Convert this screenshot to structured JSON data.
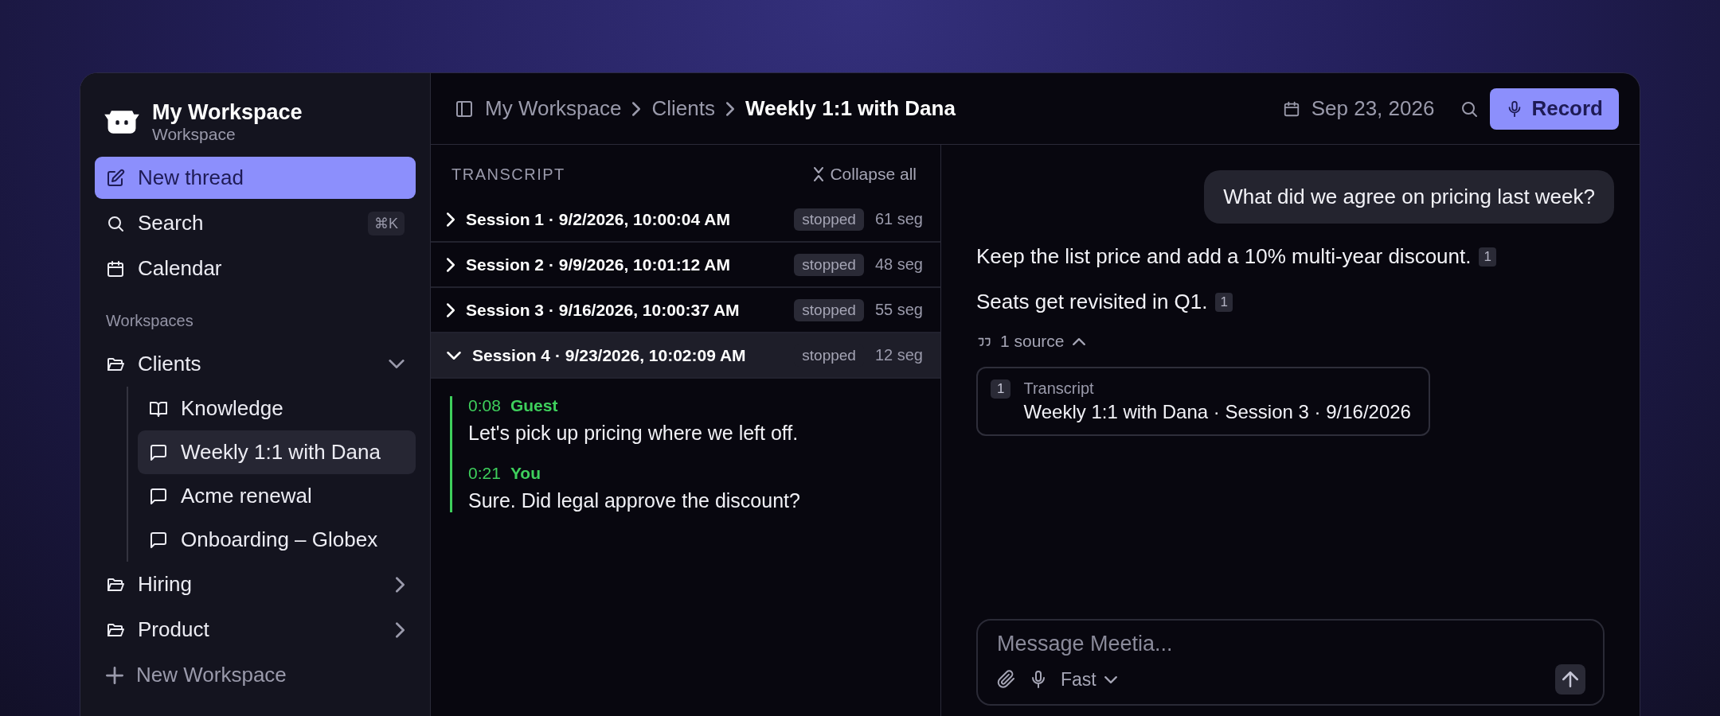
{
  "sidebar": {
    "workspace_name": "My Workspace",
    "workspace_subtitle": "Workspace",
    "nav": [
      {
        "label": "New thread",
        "kind": "primary"
      },
      {
        "label": "Search",
        "kind": "search",
        "shortcut": "⌘K"
      },
      {
        "label": "Calendar",
        "kind": "calendar"
      }
    ],
    "section_label": "Workspaces",
    "folders": [
      {
        "label": "Clients",
        "expanded": true,
        "children": [
          {
            "label": "Knowledge",
            "kind": "book",
            "selected": false
          },
          {
            "label": "Weekly 1:1 with Dana",
            "kind": "chat",
            "selected": true
          },
          {
            "label": "Acme renewal",
            "kind": "chat",
            "selected": false
          },
          {
            "label": "Onboarding – Globex",
            "kind": "chat",
            "selected": false
          }
        ]
      },
      {
        "label": "Hiring",
        "expanded": false
      },
      {
        "label": "Product",
        "expanded": false
      }
    ],
    "add_workspace": "New Workspace"
  },
  "header": {
    "breadcrumbs": [
      {
        "label": "My Workspace",
        "current": false
      },
      {
        "label": "Clients",
        "current": false
      },
      {
        "label": "Weekly 1:1 with Dana",
        "current": true
      }
    ],
    "date": "Sep 23, 2026",
    "record_button": "Record"
  },
  "transcript": {
    "title": "TRANSCRIPT",
    "collapse_all": "Collapse all",
    "sessions": [
      {
        "title": "Session 1 · 9/2/2026, 10:00:04 AM",
        "status": "stopped",
        "segment_count": "61 seg",
        "expanded": false
      },
      {
        "title": "Session 2 · 9/9/2026, 10:01:12 AM",
        "status": "stopped",
        "segment_count": "48 seg",
        "expanded": false
      },
      {
        "title": "Session 3 · 9/16/2026, 10:00:37 AM",
        "status": "stopped",
        "segment_count": "55 seg",
        "expanded": false
      },
      {
        "title": "Session 4 · 9/23/2026, 10:02:09 AM",
        "status": "stopped",
        "segment_count": "12 seg",
        "expanded": true,
        "segments": [
          {
            "time": "0:08",
            "speaker": "Guest",
            "text": "Let's pick up pricing where we left off."
          },
          {
            "time": "0:21",
            "speaker": "You",
            "text": "Sure. Did legal approve the discount?"
          }
        ]
      }
    ]
  },
  "chat": {
    "messages": [
      {
        "kind": "user",
        "text": "What did we agree on pricing last week?"
      },
      {
        "kind": "assistant",
        "paragraphs": [
          {
            "text": "Keep the list price and add a 10% multi-year discount.",
            "citation": "1"
          },
          {
            "text": "Seats get revisited in Q1.",
            "citation": "1"
          }
        ],
        "sources_toggle": "1 source",
        "sources_expanded": true,
        "sources": [
          {
            "number": "1",
            "type": "Transcript",
            "title": "Weekly 1:1 with Dana · Session 3 · 9/16/2026"
          }
        ]
      }
    ],
    "composer": {
      "placeholder": "Message Meetia...",
      "mode": "Fast"
    }
  }
}
